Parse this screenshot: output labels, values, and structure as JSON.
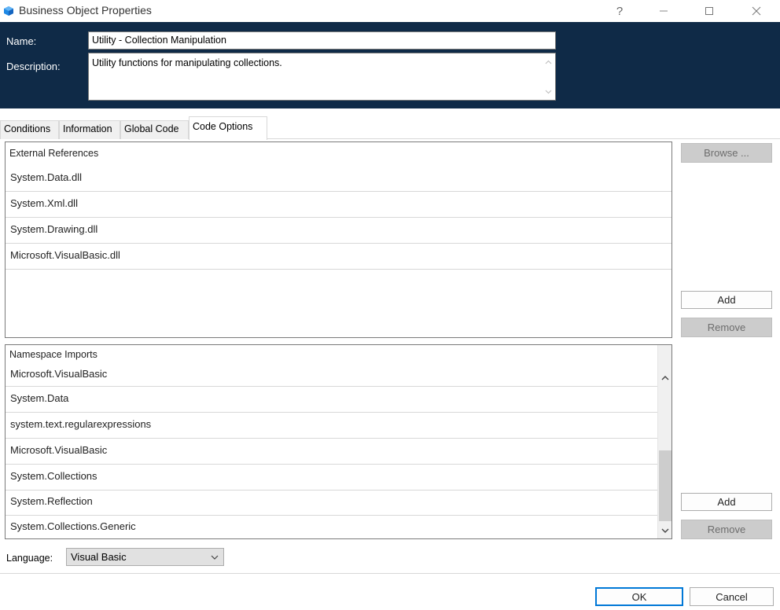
{
  "window": {
    "title": "Business Object Properties",
    "help_label": "?",
    "icon": "app-cube-icon"
  },
  "header": {
    "name_label": "Name:",
    "name_value": "Utility - Collection Manipulation",
    "description_label": "Description:",
    "description_value": "Utility functions for manipulating collections."
  },
  "tabs": [
    {
      "label": "Conditions",
      "active": false
    },
    {
      "label": "Information",
      "active": false
    },
    {
      "label": "Global Code",
      "active": false
    },
    {
      "label": "Code Options",
      "active": true
    }
  ],
  "external_references": {
    "header": "External References",
    "items": [
      "System.Data.dll",
      "System.Xml.dll",
      "System.Drawing.dll",
      "Microsoft.VisualBasic.dll"
    ],
    "browse_label": "Browse ...",
    "add_label": "Add",
    "remove_label": "Remove"
  },
  "namespace_imports": {
    "header": "Namespace Imports",
    "items": [
      "Microsoft.VisualBasic",
      "System.Data",
      "system.text.regularexpressions",
      "Microsoft.VisualBasic",
      "System.Collections",
      "System.Reflection",
      "System.Collections.Generic"
    ],
    "add_label": "Add",
    "remove_label": "Remove"
  },
  "language": {
    "label": "Language:",
    "selected": "Visual Basic"
  },
  "footer": {
    "ok_label": "OK",
    "cancel_label": "Cancel"
  },
  "colors": {
    "header_bg": "#0f2a47",
    "accent": "#0078d7",
    "icon_blue": "#1e88e5"
  }
}
